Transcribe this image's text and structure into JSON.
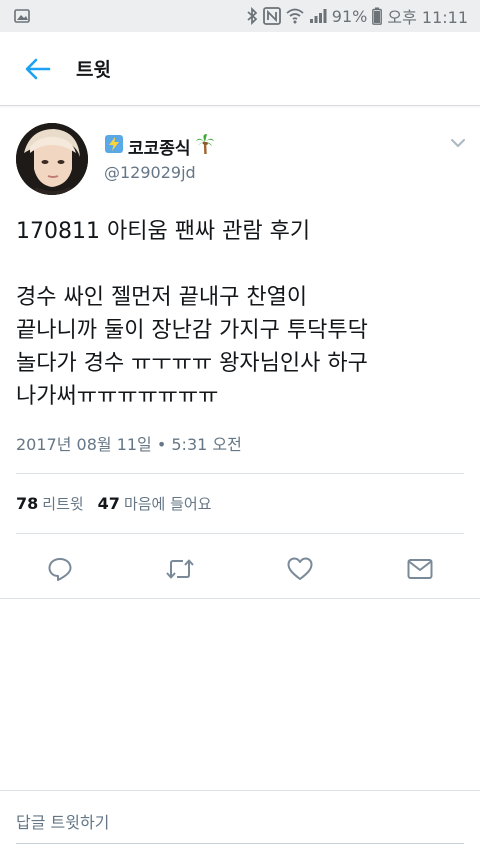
{
  "status_bar": {
    "battery": "91%",
    "time": "오후 11:11",
    "icons": [
      "gallery-icon",
      "bluetooth-icon",
      "nfc-icon",
      "wifi-icon",
      "signal-icon",
      "battery-icon"
    ]
  },
  "header": {
    "back_icon": "arrow-left-icon",
    "title": "트윗"
  },
  "tweet": {
    "author": {
      "display_name": "코코종식",
      "handle": "@129029jd",
      "name_emojis": [
        "high-voltage-icon",
        "palm-tree-icon"
      ]
    },
    "text_lines": [
      "170811 아티움 팬싸 관람 후기",
      "",
      "경수 싸인 젤먼저 끝내구 찬열이",
      "끝나니까 둘이 장난감 가지구 투닥투닥",
      "놀다가 경수 ㅠㅜㅠㅠ 왕자님인사 하구",
      "나가써ㅠㅠㅠㅠㅠㅠㅠ"
    ],
    "timestamp": "2017년 08월 11일 • 5:31 오전",
    "stats": {
      "retweets_count": "78",
      "retweets_label": "리트윗",
      "likes_count": "47",
      "likes_label": "마음에 들어요"
    },
    "actions": [
      "reply-icon",
      "retweet-icon",
      "like-icon",
      "direct-message-icon"
    ]
  },
  "reply_bar": {
    "placeholder": "답글 트윗하기"
  },
  "colors": {
    "accent": "#1da1f2",
    "text_primary": "#14171a",
    "text_secondary": "#657786",
    "status_bar_bg": "#eceef0",
    "divider": "#dde2e6"
  }
}
